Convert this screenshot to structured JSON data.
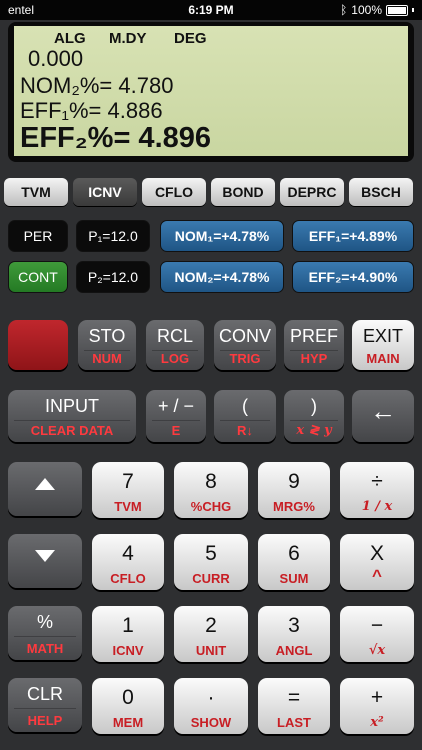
{
  "status_bar": {
    "carrier": "entel",
    "time": "6:19 PM",
    "battery": "100%"
  },
  "display": {
    "annunciators": [
      "ALG",
      "M.DY",
      "DEG"
    ],
    "line1": "0.000",
    "line2": "NOM₂%= 4.780",
    "line3": "EFF₁%= 4.886",
    "line4": "EFF₂%= 4.896"
  },
  "tabs": [
    {
      "label": "TVM",
      "active": false
    },
    {
      "label": "ICNV",
      "active": true
    },
    {
      "label": "CFLO",
      "active": false
    },
    {
      "label": "BOND",
      "active": false
    },
    {
      "label": "DEPRC",
      "active": false
    },
    {
      "label": "BSCH",
      "active": false
    }
  ],
  "vars": {
    "per": "PER",
    "p1": "P₁=12.0",
    "nom1": "NOM₁=+4.78%",
    "eff1": "EFF₁=+4.89%",
    "cont": "CONT",
    "p2": "P₂=12.0",
    "nom2": "NOM₂=+4.78%",
    "eff2": "EFF₂=+4.90%"
  },
  "keys": {
    "sto": {
      "p": "STO",
      "s": "NUM"
    },
    "rcl": {
      "p": "RCL",
      "s": "LOG"
    },
    "conv": {
      "p": "CONV",
      "s": "TRIG"
    },
    "pref": {
      "p": "PREF",
      "s": "HYP"
    },
    "exit": {
      "p": "EXIT",
      "s": "MAIN"
    },
    "input": {
      "p": "INPUT",
      "s": "CLEAR DATA"
    },
    "sign": {
      "p": "+ / −",
      "s": "E"
    },
    "paren_open": {
      "p": "(",
      "s": "R↓"
    },
    "paren_close": {
      "p": ")",
      "s": "x ≷ y"
    },
    "backspace": {
      "p": "←",
      "s": ""
    },
    "k7": {
      "p": "7",
      "s": "TVM"
    },
    "k8": {
      "p": "8",
      "s": "%CHG"
    },
    "k9": {
      "p": "9",
      "s": "MRG%"
    },
    "divide": {
      "p": "÷",
      "s": "1 / x"
    },
    "k4": {
      "p": "4",
      "s": "CFLO"
    },
    "k5": {
      "p": "5",
      "s": "CURR"
    },
    "k6": {
      "p": "6",
      "s": "SUM"
    },
    "multiply": {
      "p": "X",
      "s": "^"
    },
    "percent": {
      "p": "%",
      "s": "MATH"
    },
    "k1": {
      "p": "1",
      "s": "ICNV"
    },
    "k2": {
      "p": "2",
      "s": "UNIT"
    },
    "k3": {
      "p": "3",
      "s": "ANGL"
    },
    "minus": {
      "p": "−",
      "s": "√x"
    },
    "clr": {
      "p": "CLR",
      "s": "HELP"
    },
    "k0": {
      "p": "0",
      "s": "MEM"
    },
    "dot": {
      "p": "·",
      "s": "SHOW"
    },
    "equals": {
      "p": "=",
      "s": "LAST"
    },
    "plus": {
      "p": "+",
      "s": "x²"
    }
  }
}
